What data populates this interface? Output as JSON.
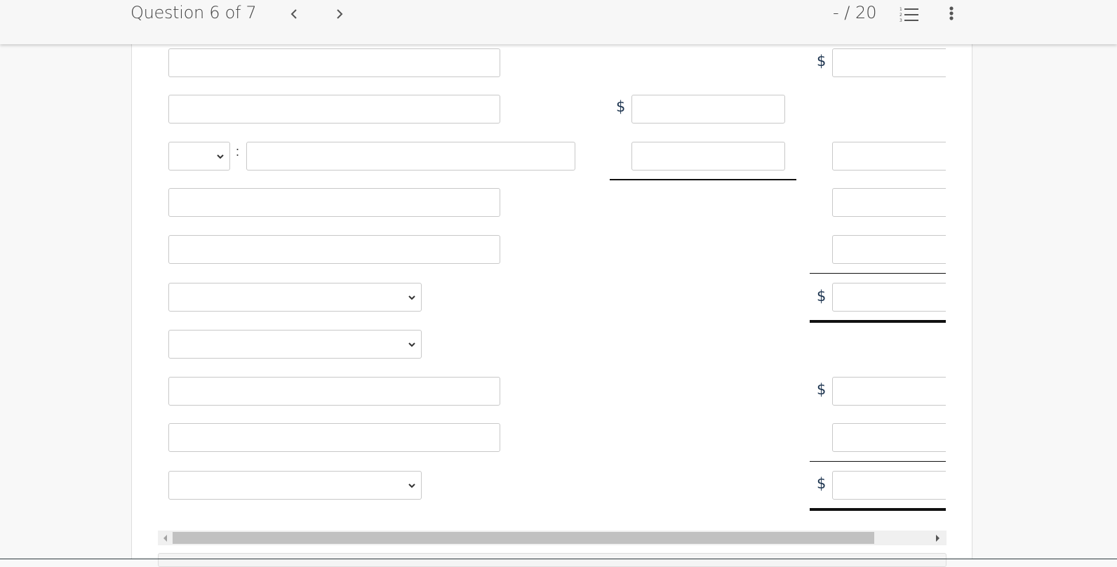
{
  "header": {
    "question_label": "Question 6 of 7",
    "score": "- / 20",
    "prev_icon": "chevron-left-icon",
    "next_icon": "chevron-right-icon",
    "list_icon": "numbered-list-icon",
    "more_icon": "more-vertical-icon"
  },
  "form": {
    "currency_symbol": "$",
    "colon": ":",
    "rows": [
      {
        "label_type": "text",
        "label_value": "",
        "col1": null,
        "col2": {
          "value": "",
          "dollar": true
        }
      },
      {
        "label_type": "text",
        "label_value": "",
        "col1": {
          "value": "",
          "dollar": true
        },
        "col2": null
      },
      {
        "label_type": "select+text",
        "select_value": "",
        "label_value": "",
        "col1": {
          "value": "",
          "dollar": false
        },
        "col2": {
          "value": "",
          "dollar": false
        }
      },
      {
        "label_type": "text",
        "label_value": "",
        "col1": null,
        "col2": {
          "value": "",
          "dollar": false
        }
      },
      {
        "label_type": "text",
        "label_value": "",
        "col1": null,
        "col2": {
          "value": "",
          "dollar": false
        }
      },
      {
        "label_type": "select",
        "select_value": "",
        "col1": null,
        "col2": {
          "value": "",
          "dollar": true
        }
      },
      {
        "label_type": "select",
        "select_value": "",
        "col1": null,
        "col2": null
      },
      {
        "label_type": "text",
        "label_value": "",
        "col1": null,
        "col2": {
          "value": "",
          "dollar": true
        }
      },
      {
        "label_type": "text",
        "label_value": "",
        "col1": null,
        "col2": {
          "value": "",
          "dollar": false
        }
      },
      {
        "label_type": "select",
        "select_value": "",
        "col1": null,
        "col2": {
          "value": "",
          "dollar": true
        }
      }
    ]
  }
}
